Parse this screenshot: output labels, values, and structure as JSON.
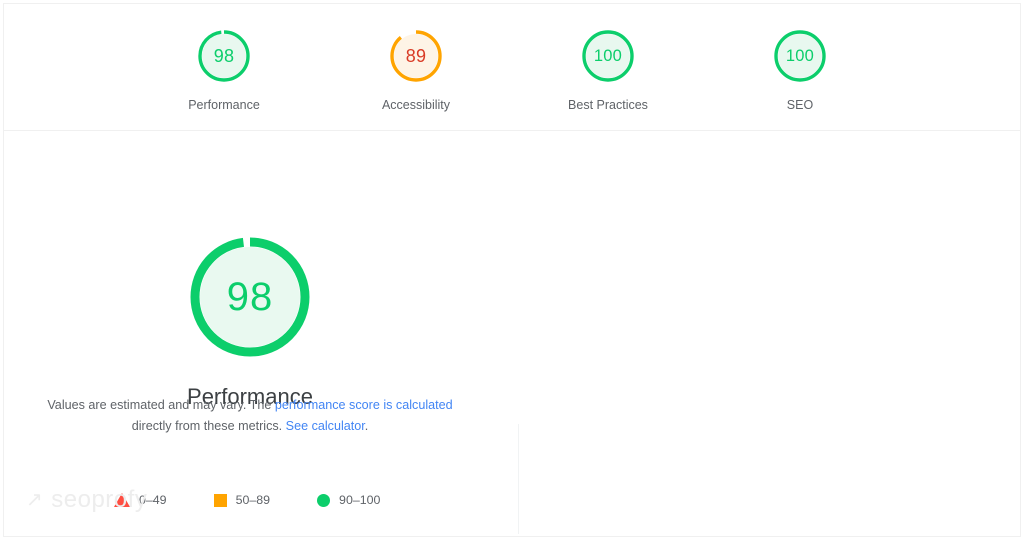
{
  "colors": {
    "green": "#0cce6b",
    "green_track": "#e8f8ef",
    "green_text": "#0cce6b",
    "orange": "#ffa400",
    "orange_track": "#fef4e6",
    "orange_text": "#d93b25",
    "red": "#ff4e42",
    "link_blue": "#4285f4",
    "label_gray": "#5f6368",
    "title_gray": "#3c4043"
  },
  "summary": {
    "gauges": [
      {
        "value": "98",
        "label": "Performance",
        "score": 98,
        "status": "pass"
      },
      {
        "value": "89",
        "label": "Accessibility",
        "score": 89,
        "status": "average"
      },
      {
        "value": "100",
        "label": "Best Practices",
        "score": 100,
        "status": "pass"
      },
      {
        "value": "100",
        "label": "SEO",
        "score": 100,
        "status": "pass"
      }
    ]
  },
  "detail": {
    "big_gauge": {
      "value": "98",
      "score": 98,
      "title": "Performance",
      "status": "pass"
    },
    "disclaimer": {
      "part1": "Values are estimated and may vary. The ",
      "link1": "performance score is calculated",
      "part2": " directly from these metrics. ",
      "link2": "See calculator",
      "part3": "."
    },
    "legend": [
      {
        "marker": "triangle-marker",
        "range": "0–49"
      },
      {
        "marker": "square-marker",
        "range": "50–89"
      },
      {
        "marker": "circle-marker",
        "range": "90–100"
      }
    ]
  },
  "watermark": {
    "arrow": "↗",
    "text": "seoprofy"
  }
}
